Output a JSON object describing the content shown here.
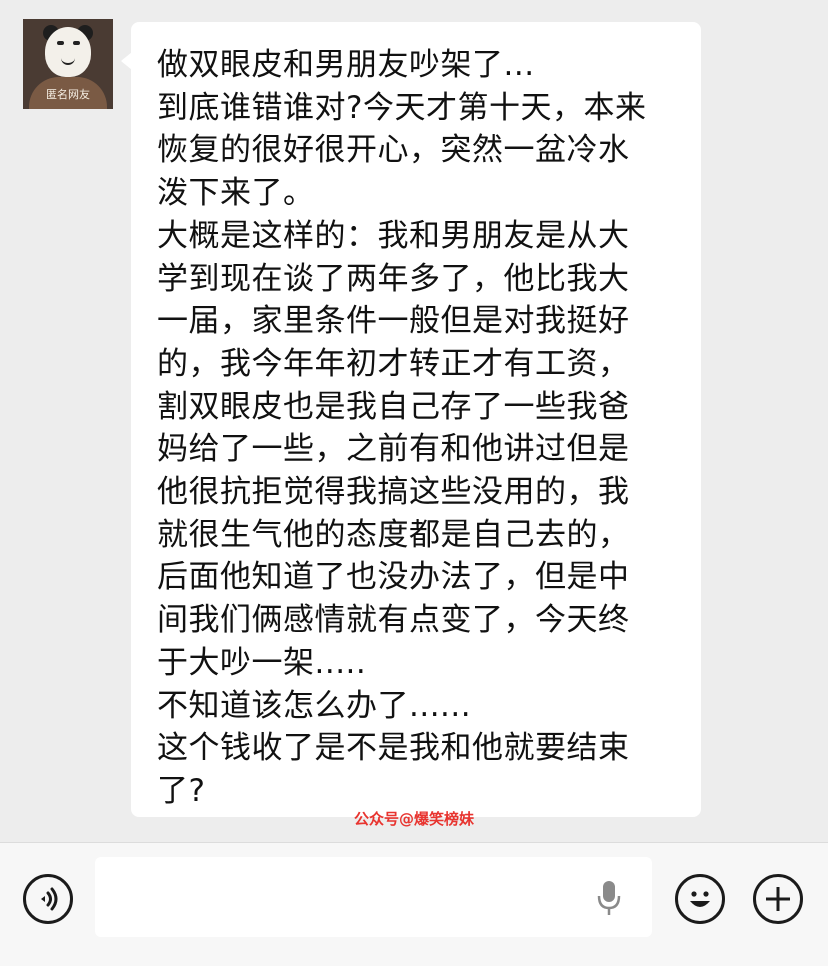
{
  "avatar": {
    "label": "匿名网友"
  },
  "message": {
    "lines": [
      "做双眼皮和男朋友吵架了...",
      "到底谁错谁对?今天才第十天，本来",
      "恢复的很好很开心，突然一盆冷水",
      "泼下来了。",
      "大概是这样的：我和男朋友是从大",
      "学到现在谈了两年多了，他比我大",
      "一届，家里条件一般但是对我挺好",
      "的，我今年年初才转正才有工资，",
      "割双眼皮也是我自己存了一些我爸",
      "妈给了一些，之前有和他讲过但是",
      "他很抗拒觉得我搞这些没用的，我",
      "就很生气他的态度都是自己去的，",
      "后面他知道了也没办法了，但是中",
      "间我们俩感情就有点变了，今天终",
      "于大吵一架.....",
      "不知道该怎么办了......",
      "这个钱收了是不是我和他就要结束",
      "了?"
    ]
  },
  "watermark": "公众号@爆笑榜妹",
  "input_bar": {
    "voice_icon": "voice-icon",
    "mic_icon": "microphone-icon",
    "emoji_icon": "emoji-icon",
    "plus_icon": "plus-icon"
  },
  "colors": {
    "chat_background": "#ededed",
    "bubble": "#ffffff",
    "watermark": "#e8342f"
  }
}
